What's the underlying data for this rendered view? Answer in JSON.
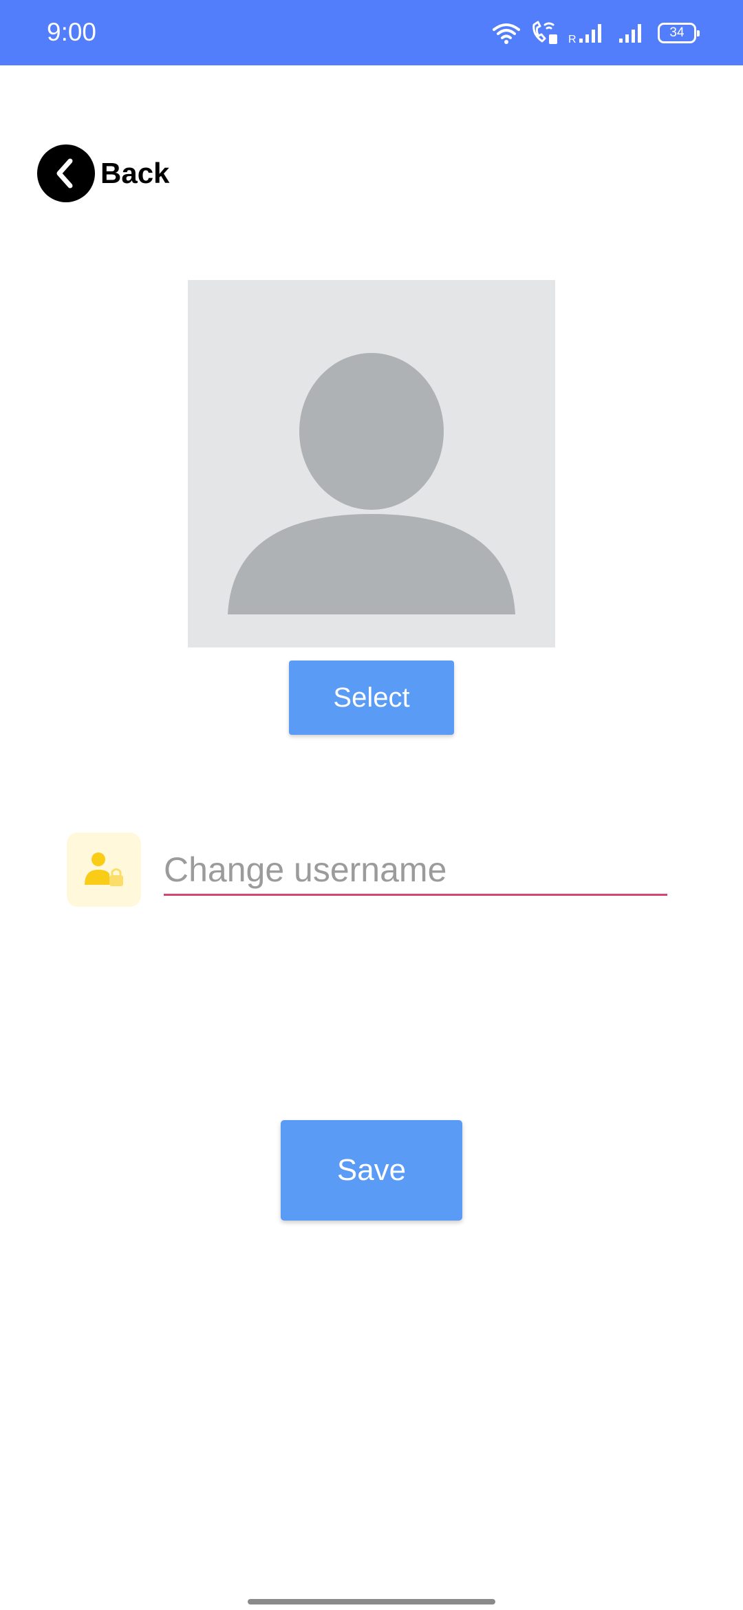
{
  "status_bar": {
    "time": "9:00",
    "battery": "34",
    "background_color": "#527EFB",
    "icons": [
      "wifi-icon",
      "wifi-calling-icon",
      "signal-r-icon",
      "signal-icon",
      "battery-icon"
    ]
  },
  "back": {
    "label": "Back",
    "icon": "chevron-left-icon"
  },
  "avatar": {
    "icon": "default-avatar-icon"
  },
  "select_button": {
    "label": "Select"
  },
  "username": {
    "icon": "user-lock-icon",
    "placeholder": "Change username",
    "value": "",
    "underline_color": "#D4456F"
  },
  "save_button": {
    "label": "Save"
  },
  "colors": {
    "accent": "#5A9BF6",
    "icon_yellow": "#F9CC18"
  }
}
